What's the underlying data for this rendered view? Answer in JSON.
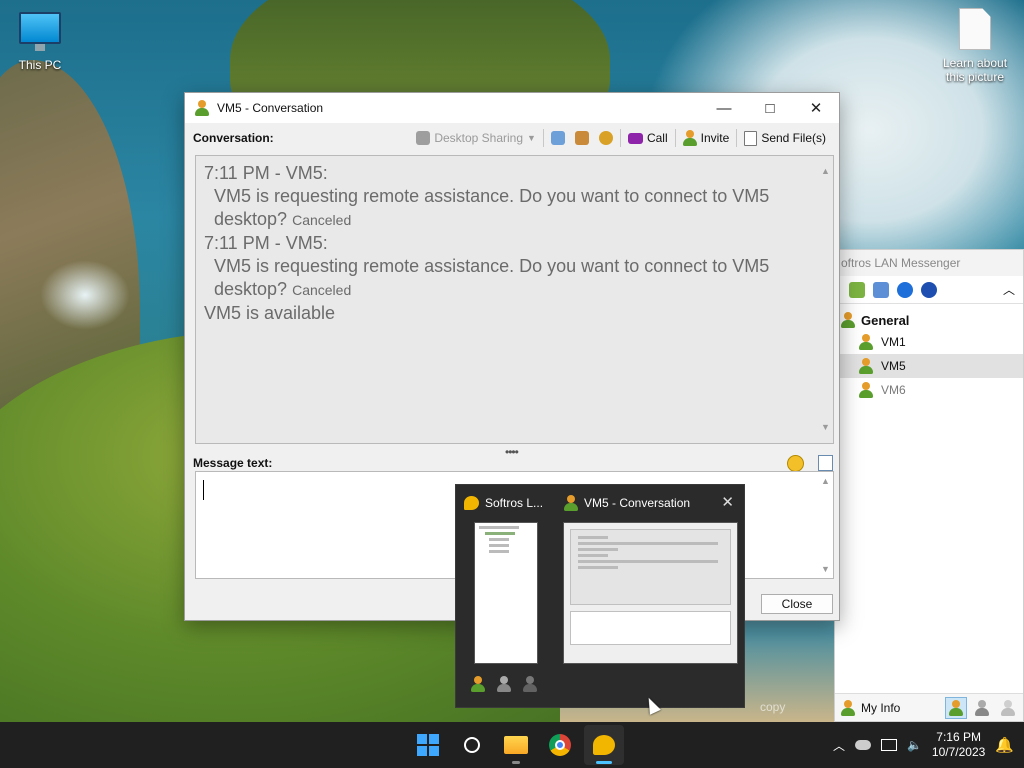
{
  "desktop": {
    "icons": [
      {
        "label": "This PC"
      },
      {
        "label": "Learn about this picture"
      }
    ],
    "watermark": "copy"
  },
  "softros": {
    "title": "oftros LAN Messenger",
    "group": "General",
    "users": [
      {
        "name": "VM1",
        "state": "online"
      },
      {
        "name": "VM5",
        "state": "online",
        "selected": true
      },
      {
        "name": "VM6",
        "state": "offline"
      }
    ],
    "my_info_label": "My Info"
  },
  "conversation": {
    "title": "VM5 - Conversation",
    "conversation_label": "Conversation:",
    "toolbar": {
      "desktop_sharing": "Desktop Sharing",
      "call": "Call",
      "invite": "Invite",
      "send_files": "Send File(s)"
    },
    "messages": [
      {
        "header": "7:11 PM - VM5:",
        "text": "VM5 is requesting remote assistance. Do you want to connect to VM5",
        "text2": "desktop?",
        "status": "Canceled"
      },
      {
        "header": "7:11 PM - VM5:",
        "text": "VM5 is requesting remote assistance. Do you want to connect to VM5",
        "text2": "desktop?",
        "status": "Canceled"
      }
    ],
    "availability": "VM5 is available",
    "splitter": "••••",
    "message_text_label": "Message text:",
    "close_label": "Close"
  },
  "taskbar_preview": {
    "tab1": "Softros L...",
    "tab2": "VM5 - Conversation",
    "close_glyph": "✕"
  },
  "taskbar": {
    "time": "7:16 PM",
    "date": "10/7/2023"
  }
}
